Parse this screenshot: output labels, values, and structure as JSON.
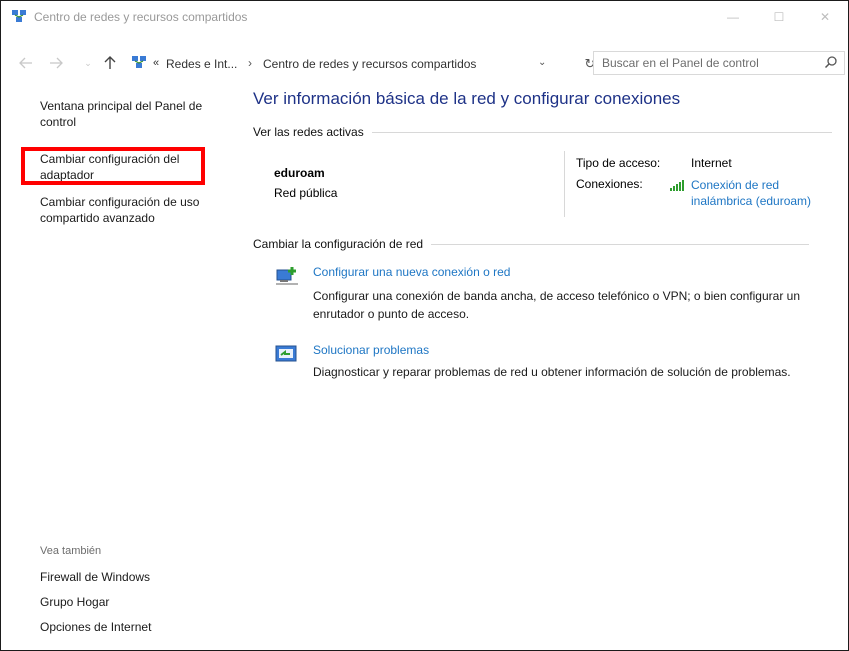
{
  "window": {
    "title": "Centro de redes y recursos compartidos",
    "minimize_glyph": "—",
    "maximize_glyph": "☐",
    "close_glyph": "✕"
  },
  "address": {
    "recent_glyph": "⌄",
    "chevron": "«",
    "crumb1": "Redes e Int...",
    "separator": "›",
    "crumb2": "Centro de redes y recursos compartidos",
    "dropdown_glyph": "⌄",
    "refresh_glyph": "↻",
    "search_placeholder": "Buscar en el Panel de control"
  },
  "sidebar": {
    "home": "Ventana principal del Panel de control",
    "adapter": "Cambiar configuración del adaptador",
    "advanced": "Cambiar configuración de uso compartido avanzado",
    "see_also": "Vea también",
    "links": [
      "Firewall de Windows",
      "Grupo Hogar",
      "Opciones de Internet"
    ]
  },
  "main": {
    "heading": "Ver información básica de la red y configurar conexiones",
    "active_section": "Ver las redes activas",
    "network": {
      "name": "eduroam",
      "type": "Red pública",
      "access_label": "Tipo de acceso:",
      "access_value": "Internet",
      "connections_label": "Conexiones:",
      "connection_link": "Conexión de red inalámbrica (eduroam)"
    },
    "change_section": "Cambiar la configuración de red",
    "tasks": [
      {
        "link": "Configurar una nueva conexión o red",
        "desc": "Configurar una conexión de banda ancha, de acceso telefónico o VPN; o bien configurar un enrutador o punto de acceso."
      },
      {
        "link": "Solucionar problemas",
        "desc": "Diagnosticar y reparar problemas de red u obtener información de solución de problemas."
      }
    ]
  },
  "colors": {
    "heading": "#1e3287",
    "link": "#1e76c4",
    "highlight_box": "#ff0000"
  }
}
